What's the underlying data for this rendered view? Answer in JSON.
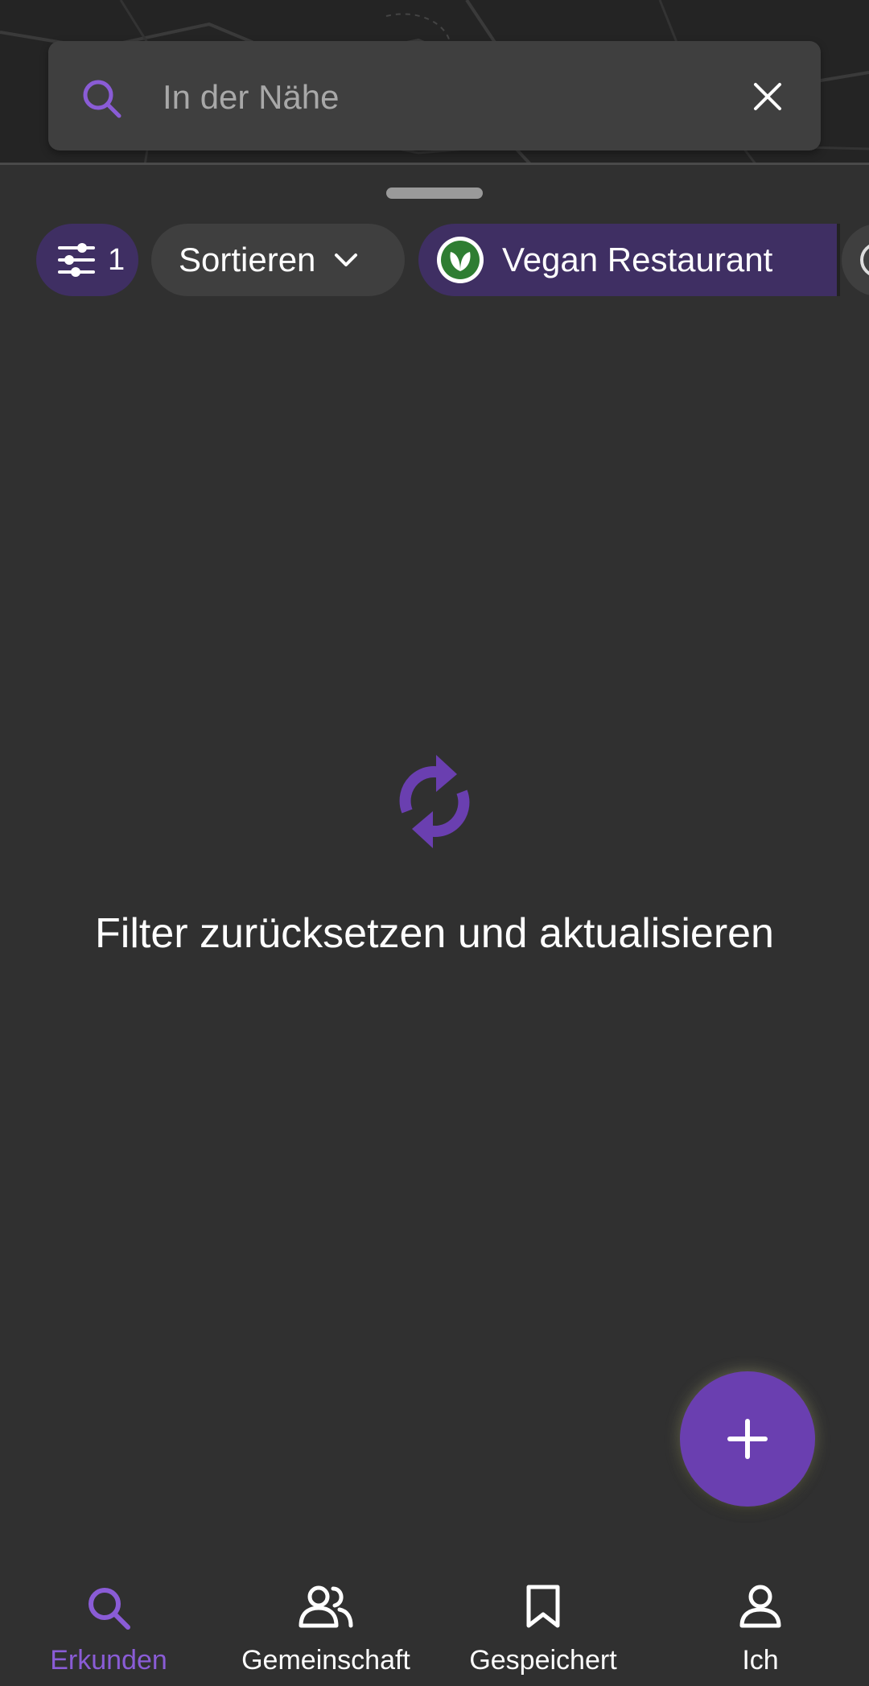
{
  "search": {
    "placeholder": "In der Nähe",
    "value": ""
  },
  "filters": {
    "active_count": "1",
    "sort_label": "Sortieren",
    "category_label": "Vegan Restaurant"
  },
  "empty_state": {
    "message": "Filter zurücksetzen und aktualisieren"
  },
  "bottom_nav": {
    "items": [
      {
        "label": "Erkunden",
        "icon": "search-icon",
        "active": true
      },
      {
        "label": "Gemeinschaft",
        "icon": "people-icon",
        "active": false
      },
      {
        "label": "Gespeichert",
        "icon": "bookmark-icon",
        "active": false
      },
      {
        "label": "Ich",
        "icon": "person-icon",
        "active": false
      }
    ]
  },
  "colors": {
    "accent": "#6a3fb0",
    "active_nav": "#8a5cd6",
    "background": "#303030",
    "vegan_badge": "#2e7d32"
  }
}
